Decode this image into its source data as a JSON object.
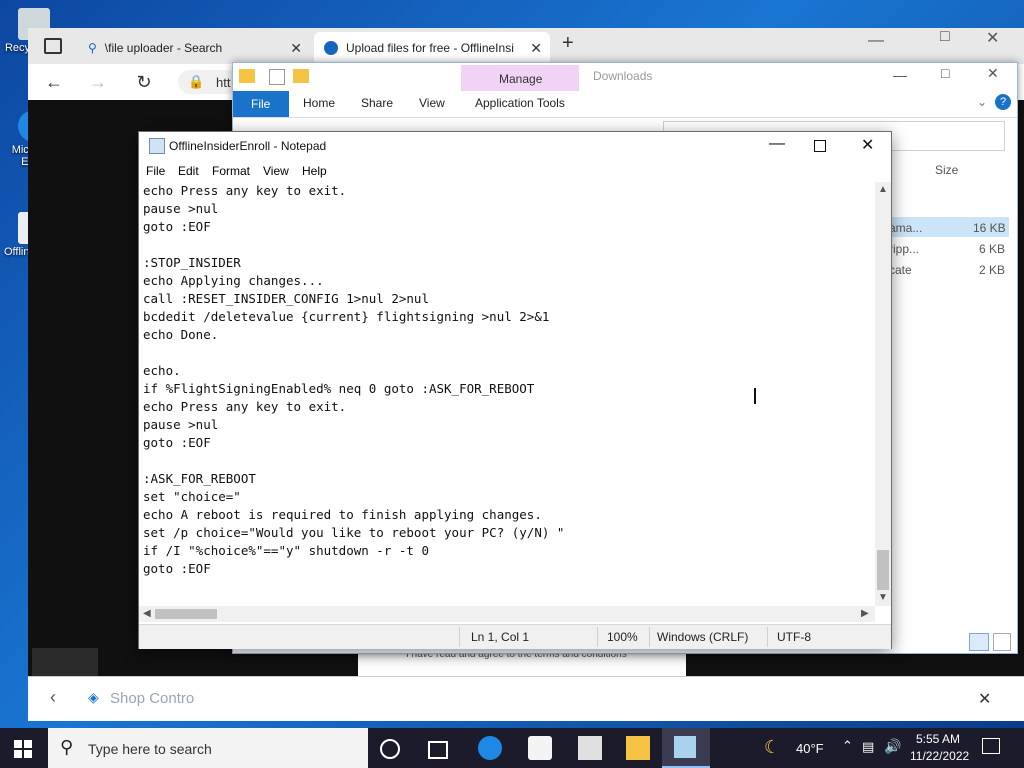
{
  "desktop": {
    "icons": [
      {
        "label": "Recycle Bin"
      },
      {
        "label": "Microsoft Edge"
      },
      {
        "label": "OfflineInsiderEnroll"
      }
    ]
  },
  "browser": {
    "tabs": [
      {
        "label": "\\file uploader - Search",
        "icon": "search-icon"
      },
      {
        "label": "Upload files for free - OfflineInsi",
        "icon": "site-icon"
      }
    ],
    "address_partial": "htt",
    "shop_bar": {
      "label": "Shop Contro"
    },
    "terms_text": "I have read and agree to the terms and conditions"
  },
  "explorer": {
    "context_tab": "Manage",
    "title": "Downloads",
    "ribbon_tabs": [
      "File",
      "Home",
      "Share",
      "View",
      "Application Tools"
    ],
    "column_size": "Size",
    "rows": [
      {
        "name": "ama...",
        "size": "16 KB"
      },
      {
        "name": "ripp...",
        "size": "6 KB"
      },
      {
        "name": "cate",
        "size": "2 KB"
      }
    ]
  },
  "notepad": {
    "title": "OfflineInsiderEnroll - Notepad",
    "menu": [
      "File",
      "Edit",
      "Format",
      "View",
      "Help"
    ],
    "lines": [
      "echo Press any key to exit.",
      "pause >nul",
      "goto :EOF",
      "",
      ":STOP_INSIDER",
      "echo Applying changes...",
      "call :RESET_INSIDER_CONFIG 1>nul 2>nul",
      "bcdedit /deletevalue {current} flightsigning >nul 2>&1",
      "echo Done.",
      "",
      "echo.",
      "if %FlightSigningEnabled% neq 0 goto :ASK_FOR_REBOOT",
      "echo Press any key to exit.",
      "pause >nul",
      "goto :EOF",
      "",
      ":ASK_FOR_REBOOT",
      "set \"choice=\"",
      "echo A reboot is required to finish applying changes.",
      "set /p choice=\"Would you like to reboot your PC? (y/N) \"",
      "if /I \"%choice%\"==\"y\" shutdown -r -t 0",
      "goto :EOF"
    ],
    "status": {
      "position": "Ln 1, Col 1",
      "zoom": "100%",
      "line_ending": "Windows (CRLF)",
      "encoding": "UTF-8"
    }
  },
  "taskbar": {
    "search_placeholder": "Type here to search",
    "weather": "40°F",
    "time": "5:55 AM",
    "date": "11/22/2022"
  }
}
